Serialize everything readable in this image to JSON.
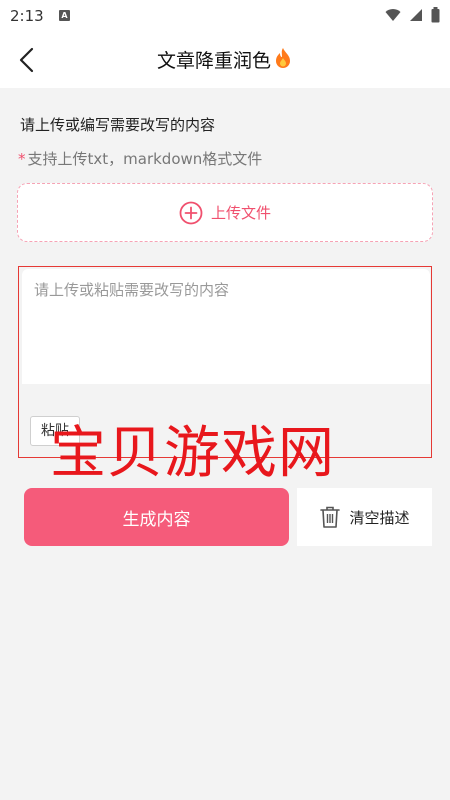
{
  "status": {
    "time": "2:13",
    "indicator": "A"
  },
  "header": {
    "title": "文章降重润色",
    "title_icon": "fire-icon"
  },
  "upload": {
    "section_title": "请上传或编写需要改写的内容",
    "hint_star": "*",
    "hint_text": "支持上传txt，markdown格式文件",
    "upload_label": "上传文件",
    "upload_icon": "plus-circle-icon"
  },
  "editor": {
    "placeholder": "请上传或粘贴需要改写的内容",
    "value": "",
    "paste_label": "粘贴"
  },
  "watermark": "宝贝游戏网",
  "actions": {
    "generate_label": "生成内容",
    "clear_label": "清空描述"
  },
  "colors": {
    "accent": "#f55b7a",
    "accent_text": "#f0506e",
    "watermark": "#e8171c"
  }
}
